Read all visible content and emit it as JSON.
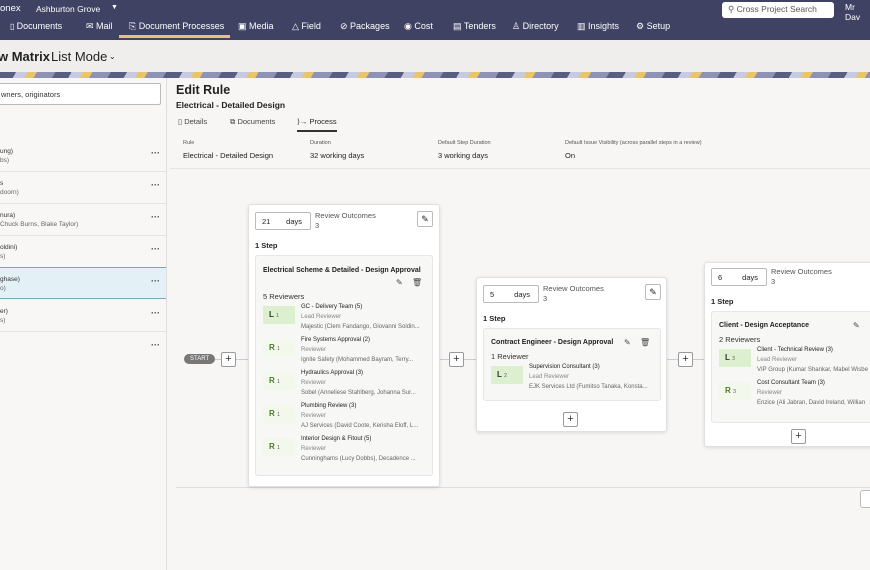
{
  "topbar": {
    "app": "onex",
    "project": "Ashburton Grove",
    "search_placeholder": "Cross Project Search",
    "user": "Mr Dav",
    "nav": [
      {
        "icon": "document-icon",
        "label": "Documents"
      },
      {
        "icon": "mail-icon",
        "label": "Mail"
      },
      {
        "icon": "process-icon",
        "label": "Document Processes"
      },
      {
        "icon": "media-icon",
        "label": "Media"
      },
      {
        "icon": "field-icon",
        "label": "Field"
      },
      {
        "icon": "package-icon",
        "label": "Packages"
      },
      {
        "icon": "cost-icon",
        "label": "Cost"
      },
      {
        "icon": "tenders-icon",
        "label": "Tenders"
      },
      {
        "icon": "directory-icon",
        "label": "Directory"
      },
      {
        "icon": "insights-icon",
        "label": "Insights"
      },
      {
        "icon": "gear-icon",
        "label": "Setup"
      }
    ]
  },
  "subheader": {
    "title_bold": "w Matrix",
    "title_mode": "List Mode"
  },
  "left": {
    "search_placeholder": "wners, originators",
    "rows": [
      {
        "a": "ung)",
        "b": "bs)"
      },
      {
        "a": "s",
        "b": "doorn)"
      },
      {
        "a": "nura)",
        "b": "Chuck Burns, Blake Taylor)"
      },
      {
        "a": "oldini)",
        "b": "s)"
      },
      {
        "a": "ghase)",
        "b": "o)"
      },
      {
        "a": "er)",
        "b": "s)"
      },
      {
        "a": "",
        "b": ""
      }
    ]
  },
  "rule": {
    "title": "Edit Rule",
    "subtitle": "Electrical - Detailed Design",
    "tabs": [
      {
        "label": "Details"
      },
      {
        "label": "Documents"
      },
      {
        "label": "Process"
      }
    ],
    "fields": [
      {
        "label": "Rule",
        "value": "Electrical - Detailed Design"
      },
      {
        "label": "Duration",
        "value": "32 working days"
      },
      {
        "label": "Default Step Duration",
        "value": "3 working days"
      },
      {
        "label": "Default Issue Visibility (across parallel steps in a review)",
        "value": "On"
      }
    ]
  },
  "flow": {
    "start": "START",
    "days_unit": "days",
    "outcomes_label": "Review Outcomes",
    "stages": [
      {
        "days": "21",
        "outcomes": "3",
        "steps": "1 Step",
        "name": "Electrical Scheme & Detailed - Design Approval",
        "reviewers": "5 Reviewers",
        "list": [
          {
            "type": "L",
            "num": "1",
            "name": "GC - Delivery Team (5)",
            "role": "Lead Reviewer",
            "org": "Majestic (Clem Fandango, Giovanni Soldin..."
          },
          {
            "type": "R",
            "num": "1",
            "name": "Fire Systems Approval (2)",
            "role": "Reviewer",
            "org": "Ignite Safety (Mohammed Bayram, Terry..."
          },
          {
            "type": "R",
            "num": "1",
            "name": "Hydraulics Approval (3)",
            "role": "Reviewer",
            "org": "Sobel (Anneliese Stahlberg, Johanna Sur..."
          },
          {
            "type": "R",
            "num": "1",
            "name": "Plumbing Review (3)",
            "role": "Reviewer",
            "org": "AJ Services (David Coote, Kerisha Eloff, L..."
          },
          {
            "type": "R",
            "num": "1",
            "name": "Interior Design & Fitout (5)",
            "role": "Reviewer",
            "org": "Cunninghams (Lucy Dobbs), Decadence ..."
          }
        ]
      },
      {
        "days": "5",
        "outcomes": "3",
        "steps": "1 Step",
        "name": "Contract Engineer - Design Approval",
        "reviewers": "1 Reviewer",
        "list": [
          {
            "type": "L",
            "num": "2",
            "name": "Supervision Consultant (3)",
            "role": "Lead Reviewer",
            "org": "EJK Services Ltd (Fumitso Tanaka, Konsta..."
          }
        ]
      },
      {
        "days": "6",
        "outcomes": "3",
        "steps": "1 Step",
        "name": "Client - Design Acceptance",
        "reviewers": "2 Reviewers",
        "list": [
          {
            "type": "L",
            "num": "3",
            "name": "Client - Technical Review (3)",
            "role": "Lead Reviewer",
            "org": "VIP Group (Kumar Shankar, Mabel Wisbe"
          },
          {
            "type": "R",
            "num": "3",
            "name": "Cost Consultant Team (3)",
            "role": "Reviewer",
            "org": "Enzice (Ali Jabran, David Ireland, Willian"
          }
        ]
      }
    ]
  }
}
